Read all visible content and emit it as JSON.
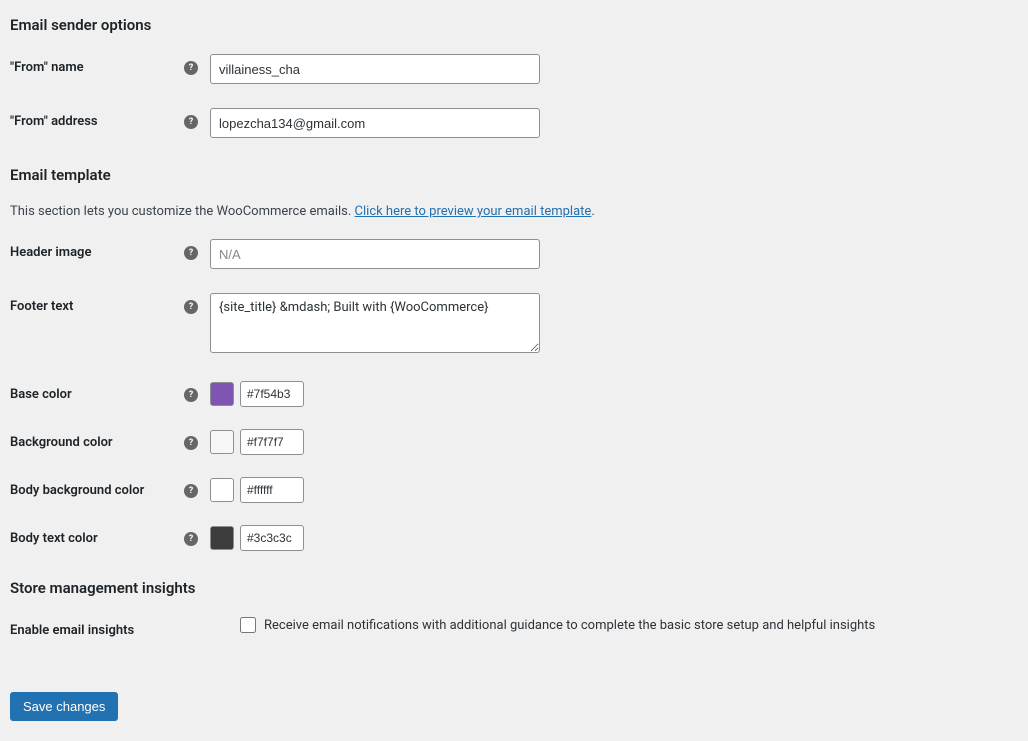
{
  "sections": {
    "sender": {
      "title": "Email sender options",
      "from_name_label": "\"From\" name",
      "from_name_value": "villainess_cha",
      "from_address_label": "\"From\" address",
      "from_address_value": "lopezcha134@gmail.com"
    },
    "template": {
      "title": "Email template",
      "description_prefix": "This section lets you customize the WooCommerce emails. ",
      "description_link": "Click here to preview your email template",
      "description_suffix": ".",
      "header_image_label": "Header image",
      "header_image_placeholder": "N/A",
      "header_image_value": "",
      "footer_text_label": "Footer text",
      "footer_text_value": "{site_title} &mdash; Built with {WooCommerce}",
      "base_color_label": "Base color",
      "base_color_value": "#7f54b3",
      "background_color_label": "Background color",
      "background_color_value": "#f7f7f7",
      "body_bg_color_label": "Body background color",
      "body_bg_color_value": "#ffffff",
      "body_text_color_label": "Body text color",
      "body_text_color_value": "#3c3c3c"
    },
    "insights": {
      "title": "Store management insights",
      "enable_label": "Enable email insights",
      "checkbox_label": "Receive email notifications with additional guidance to complete the basic store setup and helpful insights",
      "checked": false
    }
  },
  "buttons": {
    "save": "Save changes"
  },
  "help_icon": "?"
}
